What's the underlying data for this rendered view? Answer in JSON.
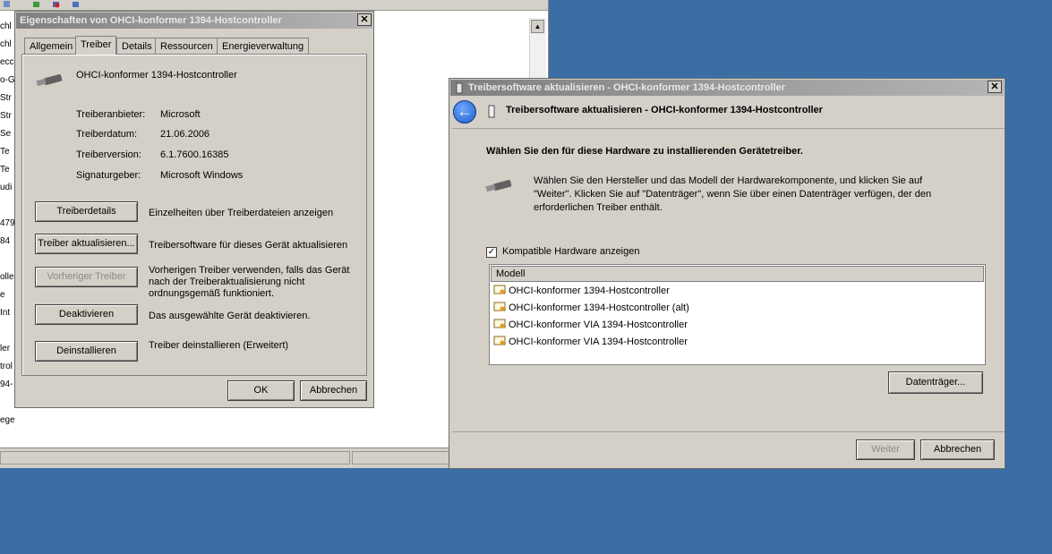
{
  "background_window": {
    "tree_fragments": [
      "chl",
      "chl",
      "ecc",
      "o-G",
      "Str",
      "Str",
      "Se",
      "Te",
      "Te",
      "udi",
      "",
      "479",
      "84",
      "",
      "olle",
      "e",
      "Int",
      "",
      "ler",
      "trol",
      "94-",
      "",
      "ege"
    ]
  },
  "properties_dialog": {
    "title": "Eigenschaften von OHCI-konformer 1394-Hostcontroller",
    "close_glyph": "✕",
    "tabs": [
      "Allgemein",
      "Treiber",
      "Details",
      "Ressourcen",
      "Energieverwaltung"
    ],
    "active_tab": "Treiber",
    "device_name": "OHCI-konformer 1394-Hostcontroller",
    "info": {
      "provider_label": "Treiberanbieter:",
      "provider_value": "Microsoft",
      "date_label": "Treiberdatum:",
      "date_value": "21.06.2006",
      "version_label": "Treiberversion:",
      "version_value": "6.1.7600.16385",
      "signer_label": "Signaturgeber:",
      "signer_value": "Microsoft Windows"
    },
    "actions": {
      "details_button": "Treiberdetails",
      "details_desc": "Einzelheiten über Treiberdateien anzeigen",
      "update_button": "Treiber aktualisieren...",
      "update_desc": "Treibersoftware für dieses Gerät aktualisieren",
      "rollback_button": "Vorheriger Treiber",
      "rollback_desc_1": "Vorherigen Treiber verwenden, falls das Gerät",
      "rollback_desc_2": "nach der Treiberaktualisierung nicht",
      "rollback_desc_3": "ordnungsgemäß funktioniert.",
      "disable_button": "Deaktivieren",
      "disable_desc": "Das ausgewählte Gerät deaktivieren.",
      "uninstall_button": "Deinstallieren",
      "uninstall_desc": "Treiber deinstallieren (Erweitert)"
    },
    "ok_button": "OK",
    "cancel_button": "Abbrechen"
  },
  "update_wizard": {
    "title": "Treibersoftware aktualisieren - OHCI-konformer 1394-Hostcontroller",
    "close_glyph": "✕",
    "back_glyph": "←",
    "header_title": "Treibersoftware aktualisieren - OHCI-konformer 1394-Hostcontroller",
    "heading": "Wählen Sie den für diese Hardware zu installierenden Gerätetreiber.",
    "instruction_1": "Wählen Sie den Hersteller und das Modell der Hardwarekomponente, und klicken Sie auf",
    "instruction_2": "\"Weiter\". Klicken Sie auf \"Datenträger\", wenn Sie über einen Datenträger verfügen, der den",
    "instruction_3": "erforderlichen Treiber enthält.",
    "compatible_checkbox_label": "Kompatible Hardware anzeigen",
    "compatible_checked": true,
    "check_glyph": "✓",
    "list_column": "Modell",
    "models": [
      "OHCI-konformer 1394-Hostcontroller",
      "OHCI-konformer 1394-Hostcontroller (alt)",
      "OHCI-konformer VIA 1394-Hostcontroller",
      "OHCI-konformer VIA 1394-Hostcontroller"
    ],
    "disk_button": "Datenträger...",
    "next_button": "Weiter",
    "cancel_button": "Abbrechen"
  },
  "colors": {
    "desktop": "#3a6ea5",
    "dialog_face": "#d4d0c8",
    "title_inactive_start": "#808080",
    "title_inactive_end": "#b5b5b5"
  }
}
